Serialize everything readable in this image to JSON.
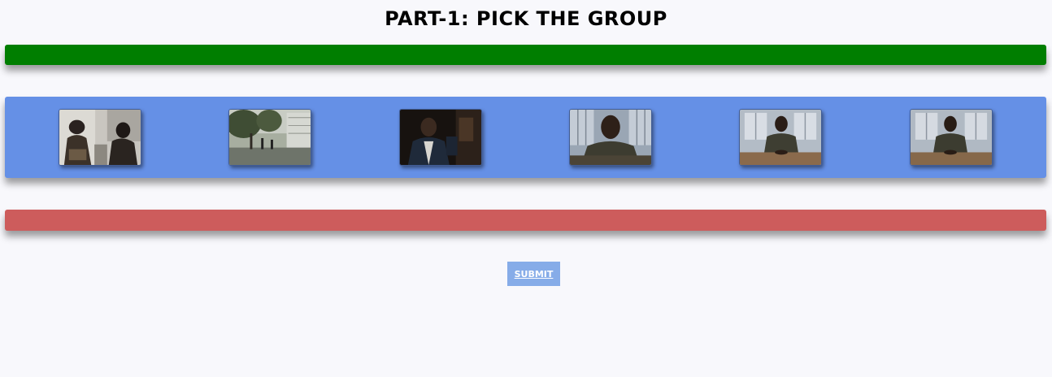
{
  "page": {
    "title": "PART-1: PICK THE GROUP"
  },
  "colors": {
    "background": "#f8f8fc",
    "top_bar": "#007e00",
    "gallery_bar": "#6590e6",
    "bottom_bar": "#cd5c5c",
    "submit_button": "#86ace8"
  },
  "gallery": {
    "thumbnails": [
      {
        "name": "video-thumbnail-1",
        "subject": "two women seated indoors"
      },
      {
        "name": "video-thumbnail-2",
        "subject": "people walking on a tree-lined street"
      },
      {
        "name": "video-thumbnail-3",
        "subject": "man in dark room"
      },
      {
        "name": "video-thumbnail-4",
        "subject": "man seated close-up by window"
      },
      {
        "name": "video-thumbnail-5",
        "subject": "man seated at table by window"
      },
      {
        "name": "video-thumbnail-6",
        "subject": "man seated at table by window"
      }
    ]
  },
  "actions": {
    "submit_label": "SUBMIT"
  }
}
